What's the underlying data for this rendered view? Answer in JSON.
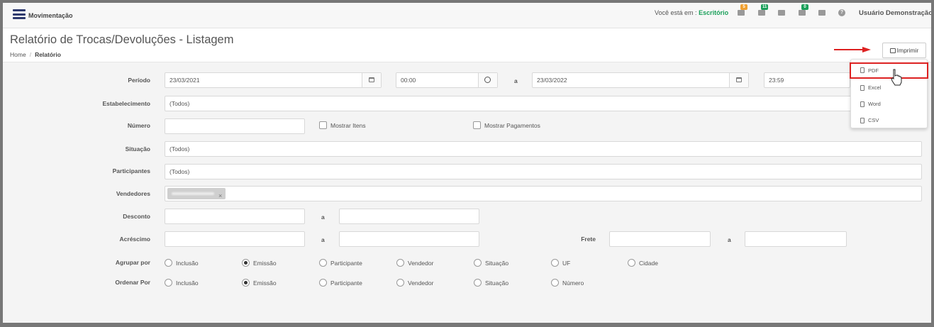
{
  "topbar": {
    "app_title": "Movimentação",
    "location_prefix": "Você está em :",
    "location": "Escritório",
    "badges": [
      {
        "icon": "sitemap-icon",
        "count": "5",
        "color": "#f0a030"
      },
      {
        "icon": "tasks-icon",
        "count": "11",
        "color": "#1aa05a"
      },
      {
        "icon": "card-icon",
        "count": "",
        "color": ""
      },
      {
        "icon": "bell-icon",
        "count": "0",
        "color": "#1aa05a"
      },
      {
        "icon": "calendar-icon",
        "count": "",
        "color": ""
      }
    ],
    "help_glyph": "?",
    "user": "Usuário Demonstração"
  },
  "header": {
    "title": "Relatório de Trocas/Devoluções - Listagem",
    "breadcrumb": [
      "Home",
      "Relatório"
    ],
    "print_label": "Imprimir"
  },
  "print_menu": [
    "PDF",
    "Excel",
    "Word",
    "CSV"
  ],
  "form": {
    "periodo": {
      "label": "Período",
      "date_from": "23/03/2021",
      "time_from": "00:00",
      "sep": "a",
      "date_to": "23/03/2022",
      "time_to": "23:59"
    },
    "estabelecimento": {
      "label": "Estabelecimento",
      "value": "(Todos)"
    },
    "numero": {
      "label": "Número",
      "value": "",
      "mostrar_itens": "Mostrar Itens",
      "mostrar_pagamentos": "Mostrar Pagamentos"
    },
    "situacao": {
      "label": "Situação",
      "value": "(Todos)"
    },
    "participantes": {
      "label": "Participantes",
      "value": "(Todos)"
    },
    "vendedores": {
      "label": "Vendedores",
      "tag_remove": "×"
    },
    "desconto": {
      "label": "Desconto",
      "sep": "a"
    },
    "acrescimo": {
      "label": "Acréscimo",
      "sep": "a"
    },
    "frete": {
      "label": "Frete",
      "sep": "a"
    },
    "agrupar": {
      "label": "Agrupar por",
      "options": [
        "Inclusão",
        "Emissão",
        "Participante",
        "Vendedor",
        "Situação",
        "UF",
        "Cidade"
      ],
      "selected": "Emissão"
    },
    "ordenar": {
      "label": "Ordenar Por",
      "options": [
        "Inclusão",
        "Emissão",
        "Participante",
        "Vendedor",
        "Situação",
        "Número"
      ],
      "selected": "Emissão"
    }
  },
  "colors": {
    "accent": "#2e3a6e",
    "location": "#1aa05a",
    "highlight": "#dd2222"
  }
}
